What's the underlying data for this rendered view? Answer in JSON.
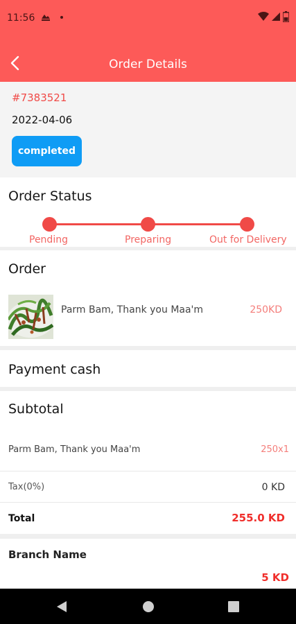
{
  "status_bar": {
    "time": "11:56",
    "left_icons": [
      "sim-card-icon",
      "dot-icon"
    ],
    "right_icons": [
      "wifi-icon",
      "signal-icon",
      "battery-icon"
    ]
  },
  "app_bar": {
    "title": "Order Details",
    "back_icon": "chevron-left-icon",
    "background": "#fd5a58"
  },
  "order": {
    "id": "#7383521",
    "date": "2022-04-06",
    "status": "completed",
    "status_color": "#0f9cf5"
  },
  "order_status": {
    "title": "Order Status",
    "steps": [
      "Pending",
      "Preparing",
      "Out for Delivery"
    ],
    "accent": "#f04a47"
  },
  "order_items": {
    "title": "Order",
    "items": [
      {
        "name": "Parm Bam, Thank you Maa'm",
        "price": "250KD"
      }
    ]
  },
  "payment": {
    "label": "Payment cash"
  },
  "subtotal": {
    "title": "Subtotal",
    "rows": [
      {
        "name": "Parm Bam, Thank you Maa'm",
        "qty": "250x1"
      }
    ],
    "tax_label": "Tax(0%)",
    "tax_value": "0 KD",
    "total_label": "Total",
    "total_value": "255.0 KD"
  },
  "branch": {
    "label": "Branch Name",
    "fee": "5 KD"
  },
  "nav_bar": {
    "buttons": [
      "back-triangle-icon",
      "home-circle-icon",
      "recents-square-icon"
    ]
  }
}
